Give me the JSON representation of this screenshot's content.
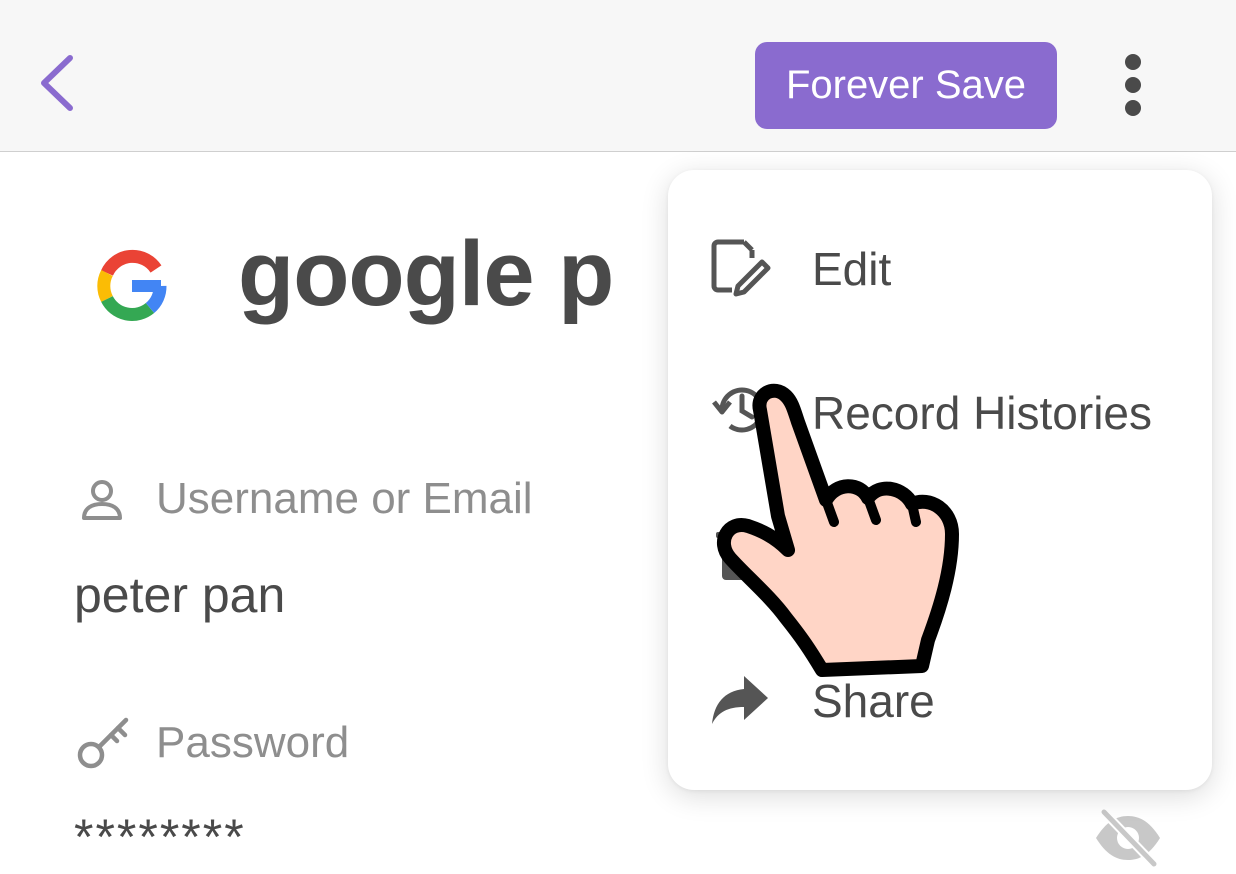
{
  "toolbar": {
    "save_label": "Forever Save",
    "accent_color": "#8a6bcf",
    "back_icon": "chevron-left-icon",
    "more_icon": "more-vertical-icon"
  },
  "entry": {
    "title": "google p",
    "logo_icon": "google-logo"
  },
  "fields": [
    {
      "label": "Username or Email",
      "value": "peter pan",
      "icon": "user-icon"
    },
    {
      "label": "Password",
      "value": "********",
      "icon": "key-icon"
    }
  ],
  "menu": {
    "items": [
      {
        "label": "Edit",
        "icon": "edit-icon"
      },
      {
        "label": "Record Histories",
        "icon": "history-icon"
      },
      {
        "label": "",
        "icon": "trash-icon"
      },
      {
        "label": "Share",
        "icon": "share-icon"
      }
    ]
  }
}
